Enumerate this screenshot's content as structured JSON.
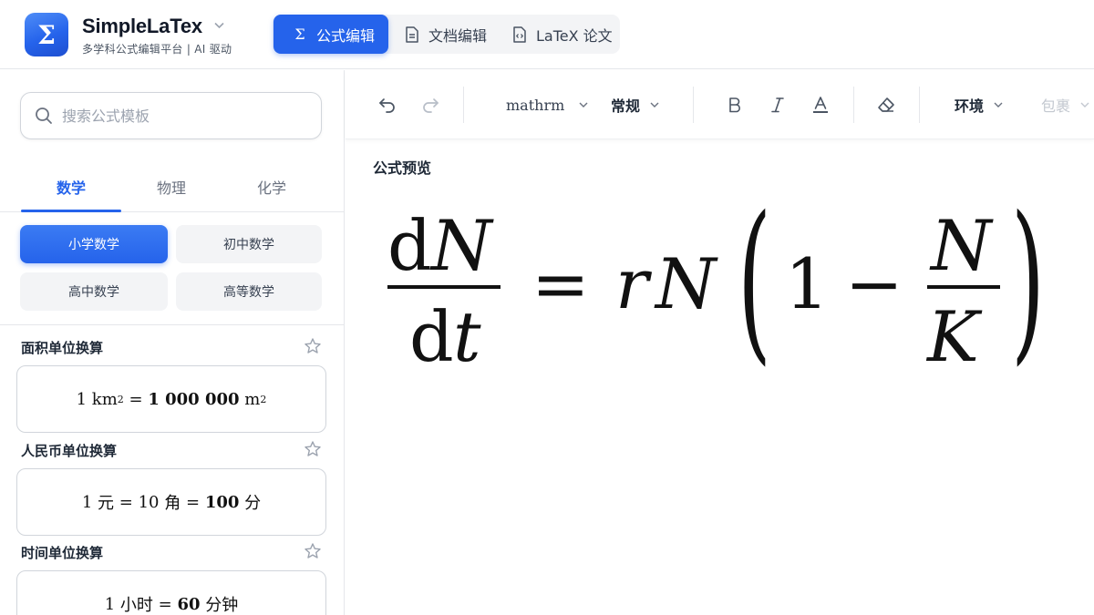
{
  "brand": {
    "name": "SimpleLaTex",
    "subtitle": "多学科公式编辑平台 | AI 驱动",
    "logo_glyph": "Σ",
    "accent_color": "#2563eb"
  },
  "mode_tabs": [
    {
      "label": "公式编辑",
      "icon": "sigma-icon",
      "active": true
    },
    {
      "label": "文档编辑",
      "icon": "document-icon",
      "active": false
    },
    {
      "label": "LaTeX 论文",
      "icon": "code-file-icon",
      "active": false
    }
  ],
  "sidebar": {
    "search_placeholder": "搜索公式模板",
    "subject_tabs": [
      {
        "label": "数学",
        "active": true
      },
      {
        "label": "物理",
        "active": false
      },
      {
        "label": "化学",
        "active": false
      }
    ],
    "levels": [
      {
        "label": "小学数学",
        "active": true
      },
      {
        "label": "初中数学",
        "active": false
      },
      {
        "label": "高中数学",
        "active": false
      },
      {
        "label": "高等数学",
        "active": false
      }
    ],
    "templates": [
      {
        "title": "面积单位换算",
        "f": {
          "a": "1",
          "u1": "km",
          "sup1": "2",
          "eq": "=",
          "b": "1 000 000",
          "u2": "m",
          "sup2": "2"
        }
      },
      {
        "title": "人民币单位换算",
        "f": {
          "a": "1",
          "u1": "元",
          "eq1": "=",
          "b": "10",
          "u2": "角",
          "eq2": "=",
          "c": "100",
          "u3": "分"
        }
      },
      {
        "title": "时间单位换算",
        "f": {
          "a": "1",
          "u1": "小时",
          "eq": "=",
          "b": "60",
          "u2": "分钟"
        }
      }
    ]
  },
  "toolbar": {
    "font_select": "mathrm",
    "style_select": "常规",
    "env_select": "环境",
    "wrap_select": "包裹",
    "icons": [
      "undo-icon",
      "redo-icon",
      "bold-icon",
      "italic-icon",
      "text-color-icon",
      "eraser-icon"
    ]
  },
  "preview": {
    "label": "公式预览",
    "formula": {
      "num_d": "d",
      "num_var": "N",
      "den_d": "d",
      "den_var": "t",
      "eq": "=",
      "r": "r",
      "N": "N",
      "lparen": "(",
      "one": "1",
      "minus": "−",
      "frac_num": "N",
      "frac_den": "K",
      "rparen": ")"
    }
  }
}
